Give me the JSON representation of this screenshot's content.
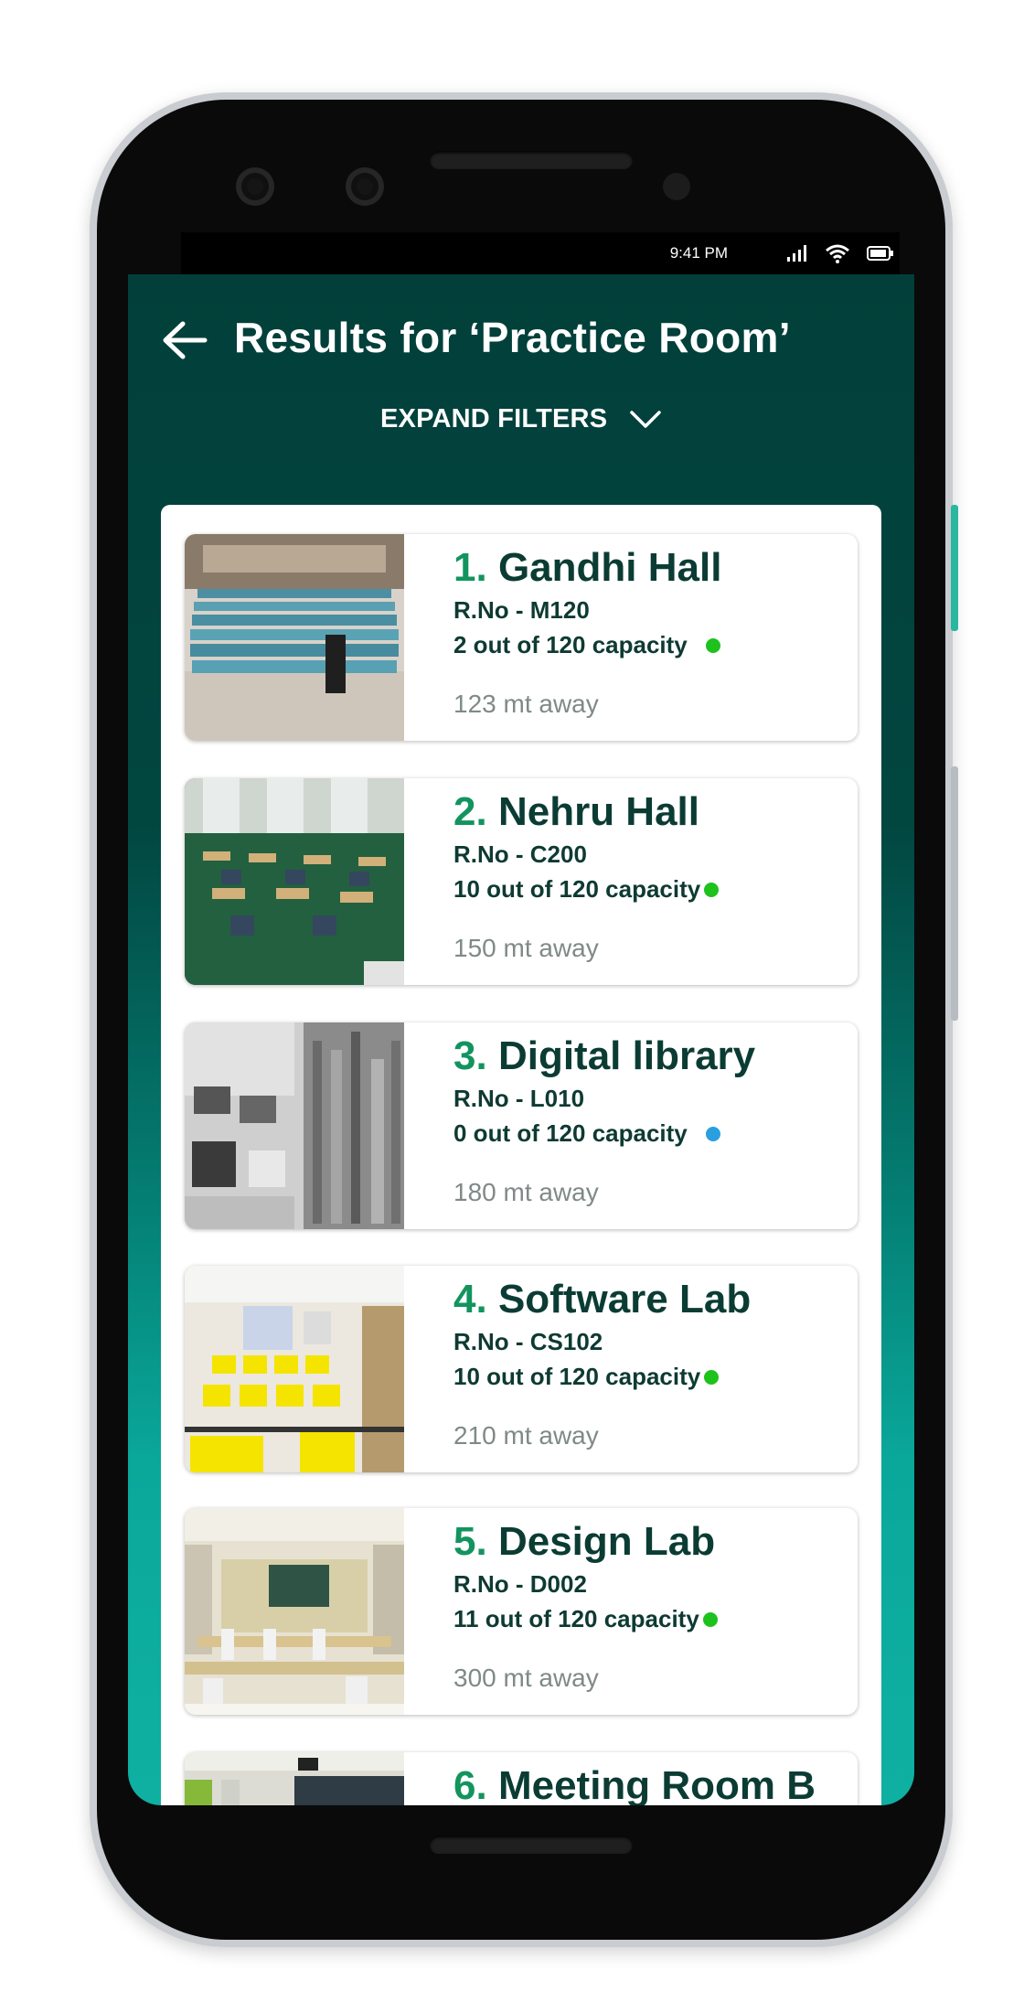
{
  "status_bar": {
    "time": "9:41 PM",
    "icons": [
      "signal-icon",
      "wifi-icon",
      "battery-icon"
    ]
  },
  "header": {
    "title": "Results for ‘Practice Room’",
    "back_icon": "back-arrow-icon"
  },
  "filters": {
    "label": "EXPAND FILTERS",
    "icon": "chevron-down-icon"
  },
  "colors": {
    "header_bg": "#024640",
    "accent_teal": "#0fb0a2",
    "number_green": "#13945f",
    "available": "#1dc21d",
    "empty": "#2a9fe0"
  },
  "results": [
    {
      "num": "1",
      "name": "Gandhi Hall",
      "room": "R.No - M120",
      "capacity": "2 out of 120 capacity",
      "status_color": "#1dc21d",
      "distance": "123 mt away",
      "image": "lecture-hall-photo"
    },
    {
      "num": "2",
      "name": "Nehru Hall",
      "room": "R.No - C200",
      "capacity": "10 out of 120 capacity",
      "status_color": "#1dc21d",
      "distance": "150 mt away",
      "image": "classroom-photo"
    },
    {
      "num": "3",
      "name": "Digital library",
      "room": "R.No - L010",
      "capacity": "0 out of 120 capacity",
      "status_color": "#2a9fe0",
      "distance": "180 mt away",
      "image": "library-photo"
    },
    {
      "num": "4",
      "name": "Software Lab",
      "room": "R.No - CS102",
      "capacity": "10 out of 120 capacity",
      "status_color": "#1dc21d",
      "distance": "210 mt away",
      "image": "computer-lab-photo"
    },
    {
      "num": "5",
      "name": "Design Lab",
      "room": "R.No - D002",
      "capacity": "11 out of 120 capacity",
      "status_color": "#1dc21d",
      "distance": "300 mt away",
      "image": "design-lab-photo"
    },
    {
      "num": "6",
      "name": "Meeting Room B",
      "room": "",
      "capacity": "",
      "status_color": "",
      "distance": "",
      "image": "meeting-room-photo"
    }
  ]
}
